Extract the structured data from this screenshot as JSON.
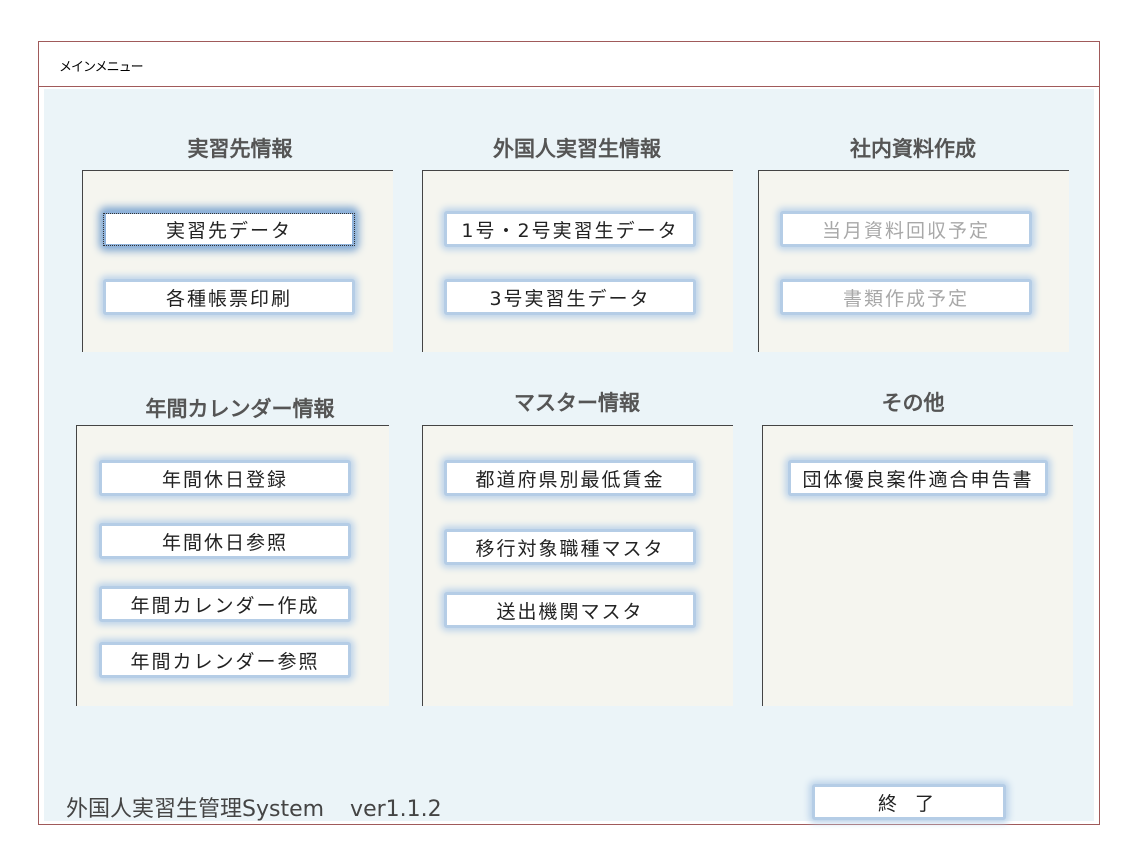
{
  "window": {
    "tab_title": "メインメニュー"
  },
  "sections": {
    "jisshusaki": {
      "title": "実習先情報",
      "buttons": [
        "実習先データ",
        "各種帳票印刷"
      ]
    },
    "gaikokujin": {
      "title": "外国人実習生情報",
      "buttons": [
        "1号・2号実習生データ",
        "3号実習生データ"
      ]
    },
    "shanai": {
      "title": "社内資料作成",
      "buttons": [
        "当月資料回収予定",
        "書類作成予定"
      ]
    },
    "calendar": {
      "title": "年間カレンダー情報",
      "buttons": [
        "年間休日登録",
        "年間休日参照",
        "年間カレンダー作成",
        "年間カレンダー参照"
      ]
    },
    "master": {
      "title": "マスター情報",
      "buttons": [
        "都道府県別最低賃金",
        "移行対象職種マスタ",
        "送出機関マスタ"
      ]
    },
    "other": {
      "title": "その他",
      "buttons": [
        "団体優良案件適合申告書"
      ]
    }
  },
  "footer": {
    "app_name": "外国人実習生管理System",
    "version": "ver1.1.2",
    "exit_label": "終 了"
  }
}
